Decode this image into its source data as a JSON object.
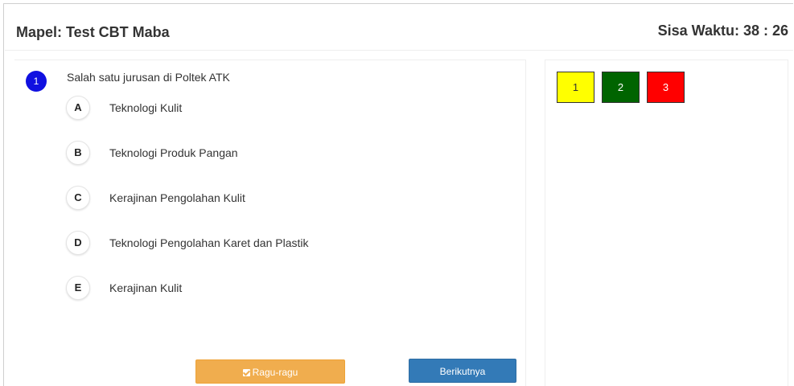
{
  "header": {
    "subject": "Mapel: Test CBT Maba",
    "timer": "Sisa Waktu: 38 : 26"
  },
  "question": {
    "number": "1",
    "text": "Salah satu jurusan di Poltek ATK",
    "options": [
      {
        "letter": "A",
        "text": "Teknologi Kulit"
      },
      {
        "letter": "B",
        "text": "Teknologi Produk Pangan"
      },
      {
        "letter": "C",
        "text": "Kerajinan Pengolahan Kulit"
      },
      {
        "letter": "D",
        "text": "Teknologi Pengolahan Karet dan Plastik"
      },
      {
        "letter": "E",
        "text": "Kerajinan Kulit"
      }
    ]
  },
  "buttons": {
    "ragu_label": "Ragu-ragu",
    "next_label": "Berikutnya",
    "ragu_icon": "check-square-icon",
    "ragu_color": "#f0ad4e",
    "next_color": "#337ab7"
  },
  "navigation": {
    "items": [
      {
        "label": "1",
        "color": "#ffff00",
        "text_color": "#333333"
      },
      {
        "label": "2",
        "color": "#006400",
        "text_color": "#ffffff"
      },
      {
        "label": "3",
        "color": "#ff0000",
        "text_color": "#ffffff"
      }
    ]
  },
  "colors": {
    "question_badge": "#1010e0"
  }
}
